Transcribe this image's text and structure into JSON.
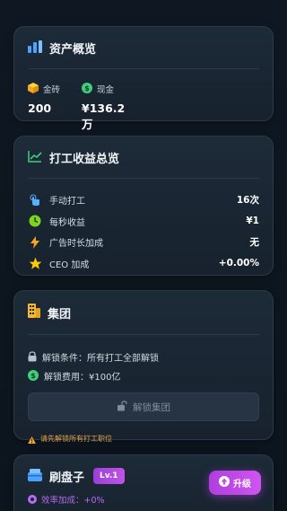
{
  "asset_overview": {
    "title": "资产概览",
    "icon": "bar-chart-icon",
    "gold_label": "金砖",
    "gold_value": "200",
    "cash_label": "现金",
    "cash_value": "¥136.2万",
    "accent": "#4aa3ff"
  },
  "income_overview": {
    "title": "打工收益总览",
    "icon": "trend-chart-icon",
    "stats": [
      {
        "label": "手动打工",
        "value": "16次",
        "icon": "tap-hand-icon"
      },
      {
        "label": "每秒收益",
        "value": "¥1",
        "icon": "clock-icon"
      },
      {
        "label": "广告时长加成",
        "value": "无",
        "icon": "lightning-icon"
      },
      {
        "label": "CEO 加成",
        "value": "+0.00%",
        "icon": "star-icon"
      }
    ]
  },
  "group": {
    "title": "集团",
    "icon": "building-icon",
    "condition": "解锁条件：所有打工全部解锁",
    "cost": "解锁费用：¥100亿",
    "unlock_button": "解锁集团",
    "warning": "请先解锁所有打工职位"
  },
  "job": {
    "title": "刷盘子",
    "icon": "dish-icon",
    "level": "Lv.1",
    "efficiency": "效率加成：+0%",
    "upgrade_button": "升级"
  }
}
